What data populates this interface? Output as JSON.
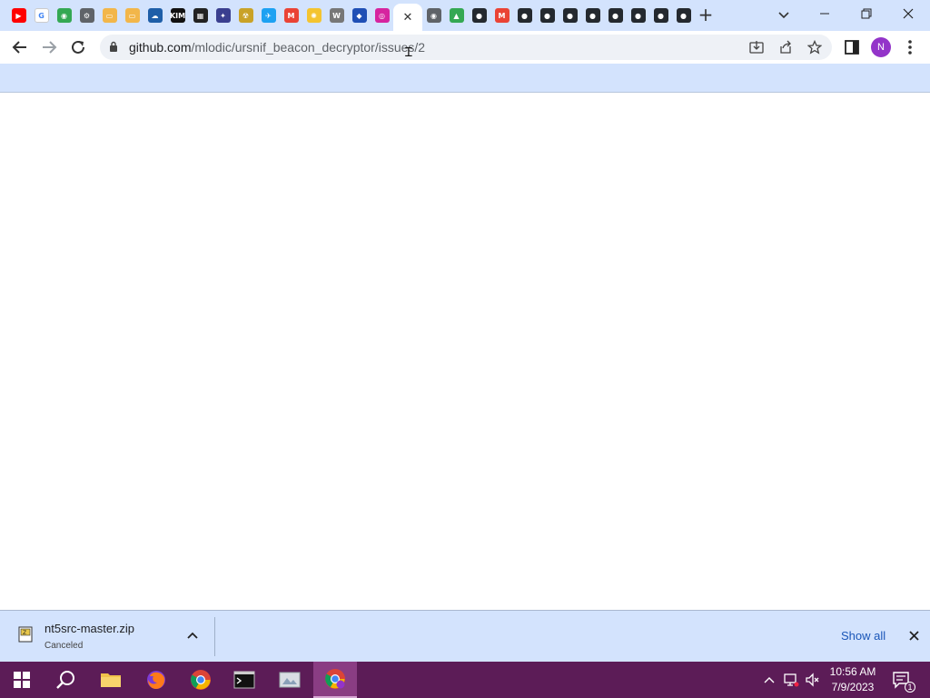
{
  "browser": {
    "url_host": "github.com",
    "url_path": "/mlodic/ursnif_beacon_decryptor/issues/2",
    "new_tab_label": "+",
    "active_tab_close": "✕",
    "profile_initial": "N",
    "favicons": [
      {
        "name": "youtube-favicon",
        "color": "#ff0000",
        "glyph": "▶"
      },
      {
        "name": "google-favicon",
        "color": "#ffffff",
        "glyph": "G"
      },
      {
        "name": "green-circle-favicon",
        "color": "#34a853",
        "glyph": "◉"
      },
      {
        "name": "settings-favicon",
        "color": "#5f6368",
        "glyph": "⚙"
      },
      {
        "name": "folder-favicon-1",
        "color": "#f2b64a",
        "glyph": "▭"
      },
      {
        "name": "folder-favicon-2",
        "color": "#f2b64a",
        "glyph": "▭"
      },
      {
        "name": "cloud-favicon",
        "color": "#1e5ea8",
        "glyph": "☁"
      },
      {
        "name": "kim-favicon",
        "color": "#111111",
        "glyph": "KIM"
      },
      {
        "name": "checker-favicon",
        "color": "#222222",
        "glyph": "▦"
      },
      {
        "name": "puzzle-favicon",
        "color": "#3a3f8f",
        "glyph": "✦"
      },
      {
        "name": "radiation-favicon",
        "color": "#c9a227",
        "glyph": "☢"
      },
      {
        "name": "twitter-favicon",
        "color": "#1da1f2",
        "glyph": "✈"
      },
      {
        "name": "gmail-favicon",
        "color": "#ea4335",
        "glyph": "M"
      },
      {
        "name": "bulb-favicon",
        "color": "#f4c430",
        "glyph": "✺"
      },
      {
        "name": "wiki-favicon",
        "color": "#777777",
        "glyph": "W"
      },
      {
        "name": "sonic-favicon",
        "color": "#1f4fb5",
        "glyph": "◆"
      },
      {
        "name": "instagram-favicon",
        "color": "#d6249f",
        "glyph": "◎"
      }
    ],
    "trailing_favicons": [
      {
        "name": "chrome-favicon",
        "color": "#5f6368",
        "glyph": "◉"
      },
      {
        "name": "drive-favicon",
        "color": "#34a853",
        "glyph": "▲"
      },
      {
        "name": "github-favicon-1",
        "color": "#24292f",
        "glyph": "●"
      },
      {
        "name": "gmail-favicon-2",
        "color": "#ea4335",
        "glyph": "M"
      },
      {
        "name": "github-favicon-2",
        "color": "#24292f",
        "glyph": "●"
      },
      {
        "name": "github-favicon-3",
        "color": "#24292f",
        "glyph": "●"
      },
      {
        "name": "github-favicon-4",
        "color": "#24292f",
        "glyph": "●"
      },
      {
        "name": "github-favicon-5",
        "color": "#24292f",
        "glyph": "●"
      },
      {
        "name": "github-favicon-6",
        "color": "#24292f",
        "glyph": "●"
      },
      {
        "name": "github-favicon-7",
        "color": "#24292f",
        "glyph": "●"
      },
      {
        "name": "github-favicon-8",
        "color": "#24292f",
        "glyph": "●"
      },
      {
        "name": "github-favicon-9",
        "color": "#24292f",
        "glyph": "●"
      }
    ]
  },
  "download_shelf": {
    "file_name": "nt5src-master.zip",
    "status": "Canceled",
    "show_all_label": "Show all"
  },
  "taskbar": {
    "time": "10:56 AM",
    "date": "7/9/2023",
    "notification_count": "1"
  },
  "colors": {
    "tab_strip": "#d3e3fd",
    "taskbar": "#5c1c57",
    "accent_link": "#1a56b8"
  }
}
